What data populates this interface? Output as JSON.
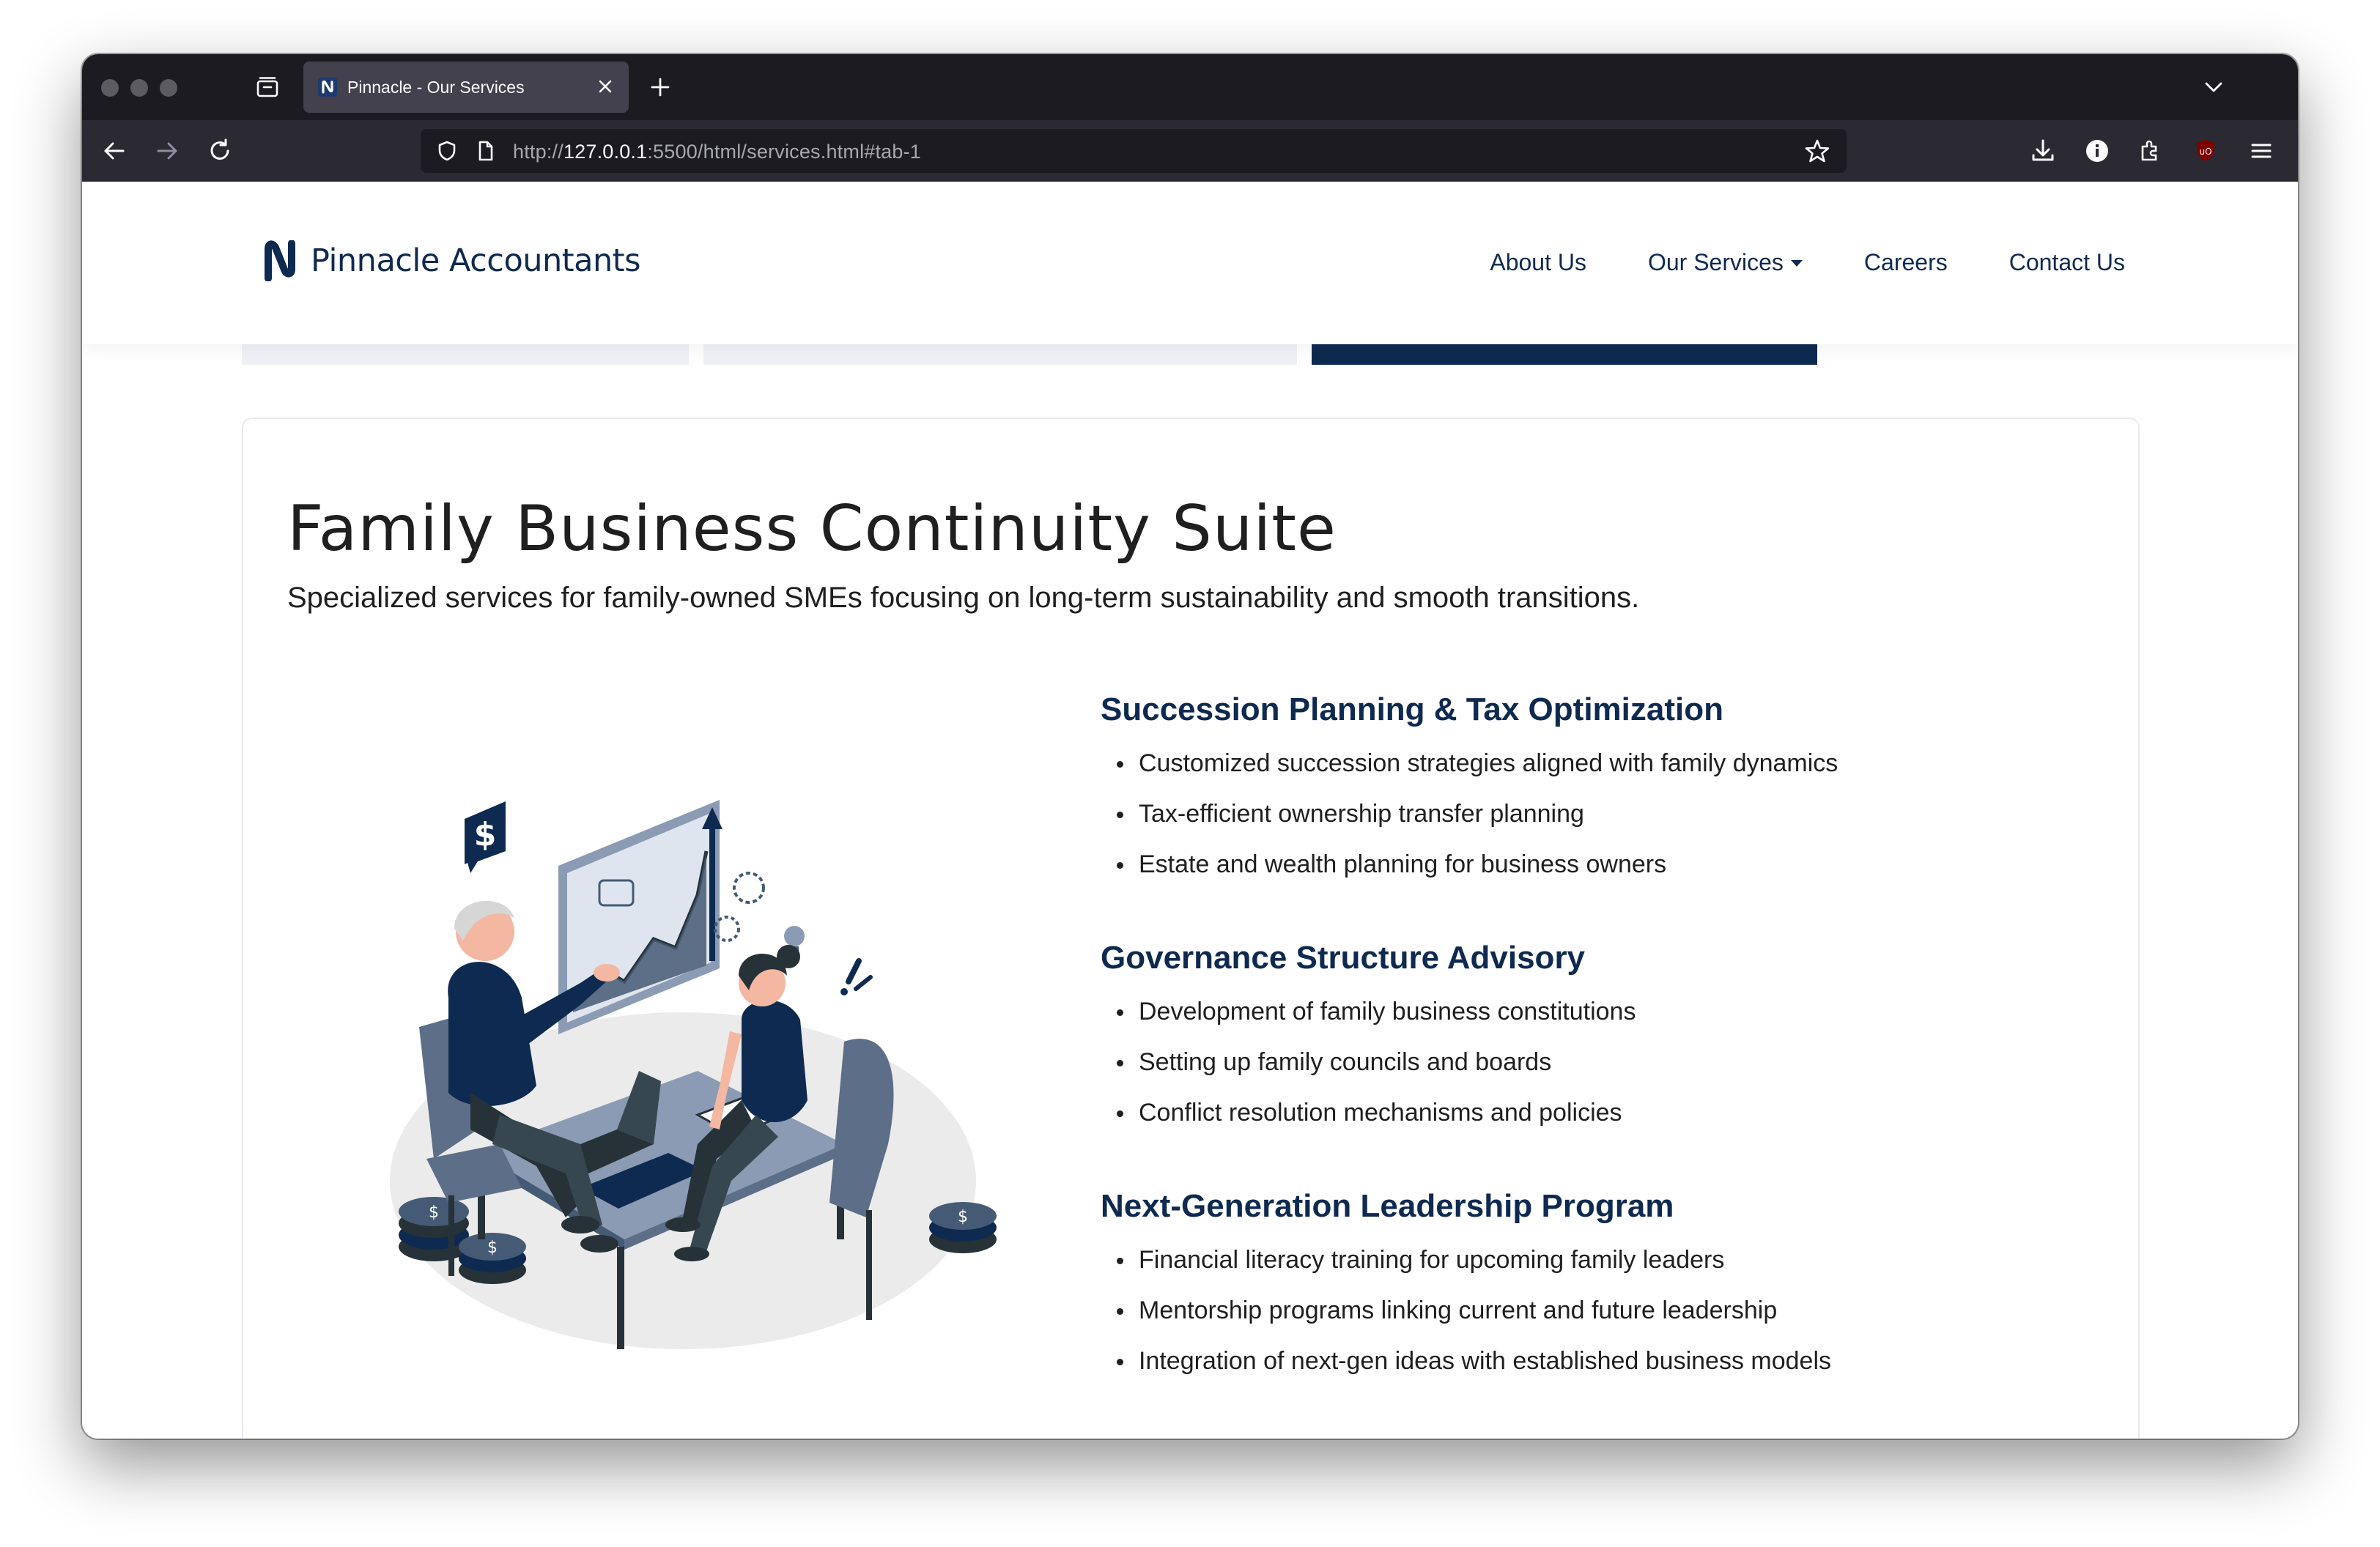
{
  "browser": {
    "tab_title": "Pinnacle - Our Services",
    "url_prefix": "http://",
    "url_host": "127.0.0.1",
    "url_rest": ":5500/html/services.html#tab-1"
  },
  "site": {
    "logo_text": "Pinnacle Accountants",
    "nav": {
      "about": "About Us",
      "services": "Our Services",
      "careers": "Careers",
      "contact": "Contact Us"
    }
  },
  "colors": {
    "brand_navy": "#0f2a50",
    "active_tab": "#0f2a50",
    "inactive_tab": "#eef1f6"
  },
  "card": {
    "title": "Family Business Continuity Suite",
    "subtitle": "Specialized services for family-owned SMEs focusing on long-term sustainability and smooth transitions.",
    "services": [
      {
        "title": "Succession Planning & Tax Optimization",
        "items": [
          "Customized succession strategies aligned with family dynamics",
          "Tax-efficient ownership transfer planning",
          "Estate and wealth planning for business owners"
        ]
      },
      {
        "title": "Governance Structure Advisory",
        "items": [
          "Development of family business constitutions",
          "Setting up family councils and boards",
          "Conflict resolution mechanisms and policies"
        ]
      },
      {
        "title": "Next-Generation Leadership Program",
        "items": [
          "Financial literacy training for upcoming family leaders",
          "Mentorship programs linking current and future leadership",
          "Integration of next-gen ideas with established business models"
        ]
      }
    ]
  }
}
